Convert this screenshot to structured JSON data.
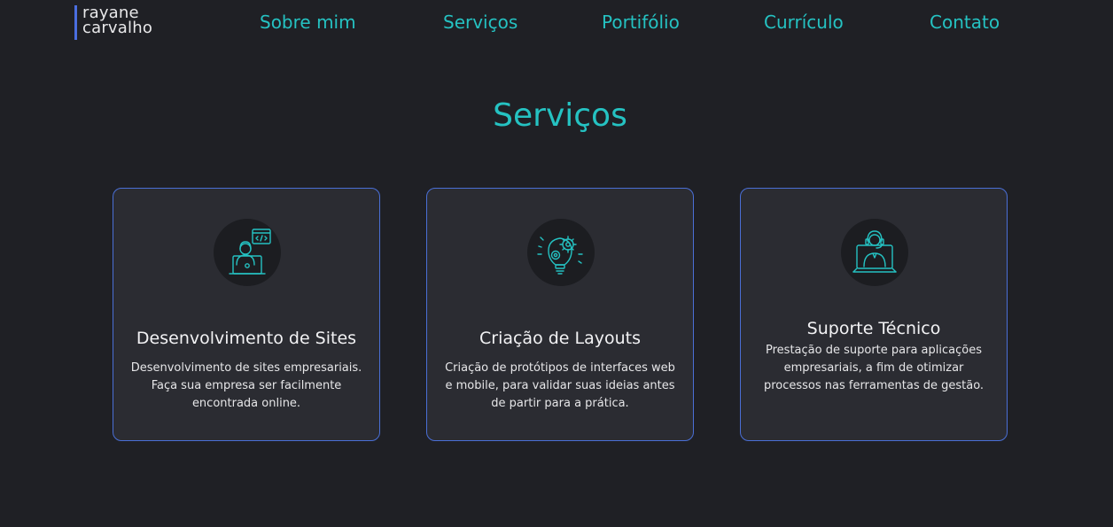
{
  "header": {
    "logo_line1": "rayane",
    "logo_line2": "carvalho",
    "nav": [
      {
        "label": "Sobre mim"
      },
      {
        "label": "Serviços"
      },
      {
        "label": "Portifólio"
      },
      {
        "label": "Currículo"
      },
      {
        "label": "Contato"
      }
    ]
  },
  "services": {
    "title": "Serviços",
    "cards": [
      {
        "icon": "web-developer-icon",
        "title": "Desenvolvimento de Sites",
        "description": "Desenvolvimento de sites empresariais. Faça sua empresa ser facilmente encontrada online."
      },
      {
        "icon": "lightbulb-gear-icon",
        "title": "Criação de Layouts",
        "description": "Criação de protótipos de interfaces web e mobile, para validar suas ideias antes de partir para a prática."
      },
      {
        "icon": "tech-support-icon",
        "title": "Suporte Técnico",
        "description": "Prestação de suporte para aplicações empresariais, a fim de otimizar processos nas ferramentas de gestão."
      }
    ]
  },
  "colors": {
    "background": "#1f2025",
    "accent": "#25c2c2",
    "card_background": "#2b2c32",
    "card_border": "#4a6fd6",
    "logo_bar": "#4a6ee0"
  }
}
